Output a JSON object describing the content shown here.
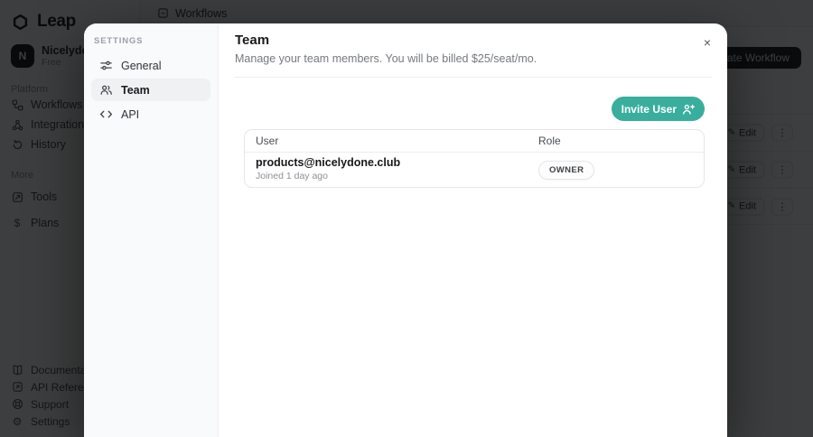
{
  "brand": {
    "name": "Leap"
  },
  "account": {
    "initial": "N",
    "name": "Nicelydone",
    "plan": "Free"
  },
  "sidebar": {
    "sections": [
      {
        "label": "Platform",
        "items": [
          {
            "label": "Workflows"
          },
          {
            "label": "Integrations"
          },
          {
            "label": "History"
          }
        ]
      },
      {
        "label": "More",
        "items": [
          {
            "label": "Tools"
          },
          {
            "label": "Plans"
          }
        ]
      }
    ],
    "footer": [
      {
        "label": "Documentation"
      },
      {
        "label": "API Reference"
      },
      {
        "label": "Support"
      },
      {
        "label": "Settings"
      }
    ]
  },
  "topbar": {
    "active_tab": "Workflows"
  },
  "main": {
    "create_button": "Create Workflow",
    "edit_label": "Edit",
    "row_count": 3
  },
  "icons": {
    "kebab": "⋮",
    "close": "×",
    "pencil": "✎",
    "plans": "$",
    "gear": "⚙"
  },
  "settings_modal": {
    "nav_heading": "SETTINGS",
    "nav_items": [
      {
        "label": "General"
      },
      {
        "label": "Team",
        "active": true
      },
      {
        "label": "API"
      }
    ],
    "title": "Team",
    "subtitle": "Manage your team members. You will be billed $25/seat/mo.",
    "invite_button": "Invite User",
    "table": {
      "headers": {
        "user": "User",
        "role": "Role"
      },
      "rows": [
        {
          "user": "products@nicelydone.club",
          "joined": "Joined 1 day ago",
          "role": "OWNER"
        }
      ]
    }
  },
  "colors": {
    "accent_teal": "#39ae9d",
    "dark_button": "#17181a",
    "overlay": "rgba(7,8,9,0.78)"
  }
}
